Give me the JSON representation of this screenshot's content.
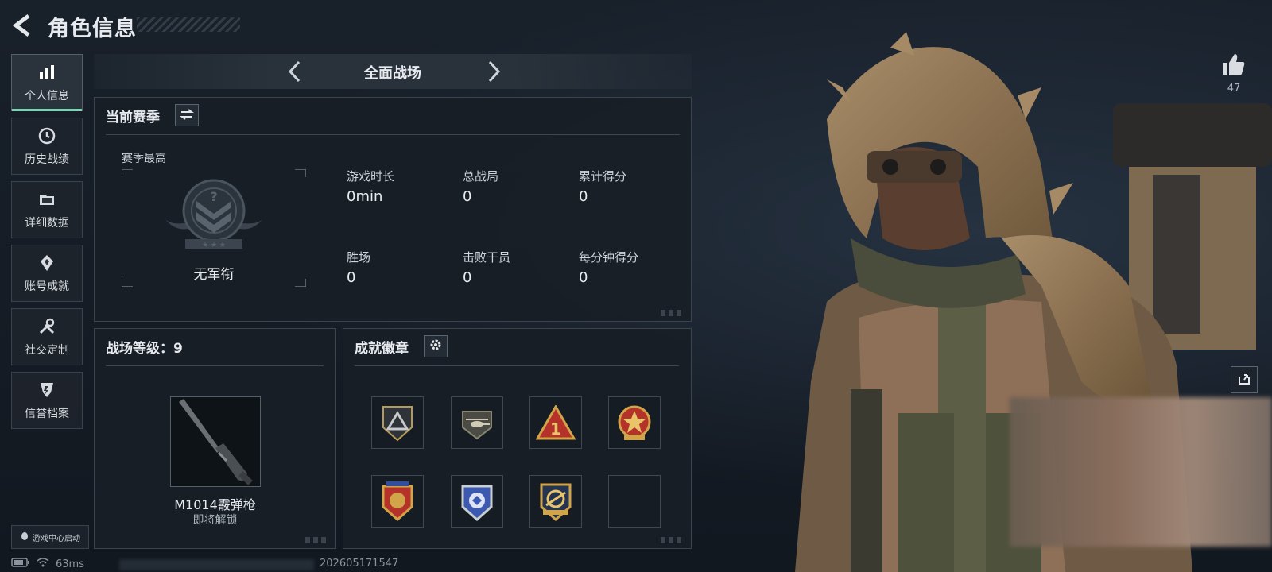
{
  "header": {
    "title": "角色信息",
    "back_icon": "back-arrow-icon"
  },
  "sidebar": {
    "items": [
      {
        "label": "个人信息",
        "icon": "bar-chart-icon",
        "active": true
      },
      {
        "label": "历史战绩",
        "icon": "clock-history-icon",
        "active": false
      },
      {
        "label": "详细数据",
        "icon": "folder-icon",
        "active": false
      },
      {
        "label": "账号成就",
        "icon": "achievement-icon",
        "active": false
      },
      {
        "label": "社交定制",
        "icon": "tools-icon",
        "active": false
      },
      {
        "label": "信誉档案",
        "icon": "credit-shield-icon",
        "active": false
      }
    ],
    "launch_label": "游戏中心启动"
  },
  "mode": {
    "title": "全面战场"
  },
  "season": {
    "heading": "当前赛季",
    "best_label": "赛季最高",
    "rank_label": "无军衔",
    "stats": [
      {
        "label": "游戏时长",
        "value": "0min"
      },
      {
        "label": "总战局",
        "value": "0"
      },
      {
        "label": "累计得分",
        "value": "0"
      },
      {
        "label": "胜场",
        "value": "0"
      },
      {
        "label": "击败干员",
        "value": "0"
      },
      {
        "label": "每分钟得分",
        "value": "0"
      }
    ]
  },
  "level": {
    "heading": "战场等级：9",
    "reward_name": "M1014霰弹枪",
    "reward_status": "即将解锁"
  },
  "badges": {
    "heading": "成就徽章",
    "items": [
      "triangle-badge",
      "helicopter-badge",
      "number-one-badge",
      "star-seal-badge",
      "shield-emblem-badge",
      "blue-crest-badge",
      "gold-crest-badge",
      "empty-slot"
    ]
  },
  "right": {
    "like_count": "47"
  },
  "statusbar": {
    "ping": "63ms",
    "build": "202605171547"
  },
  "colors": {
    "accent": "#7cd6b6",
    "badge_gold": "#d2a44a",
    "badge_red": "#b5322b",
    "badge_blue": "#3c59b0"
  }
}
